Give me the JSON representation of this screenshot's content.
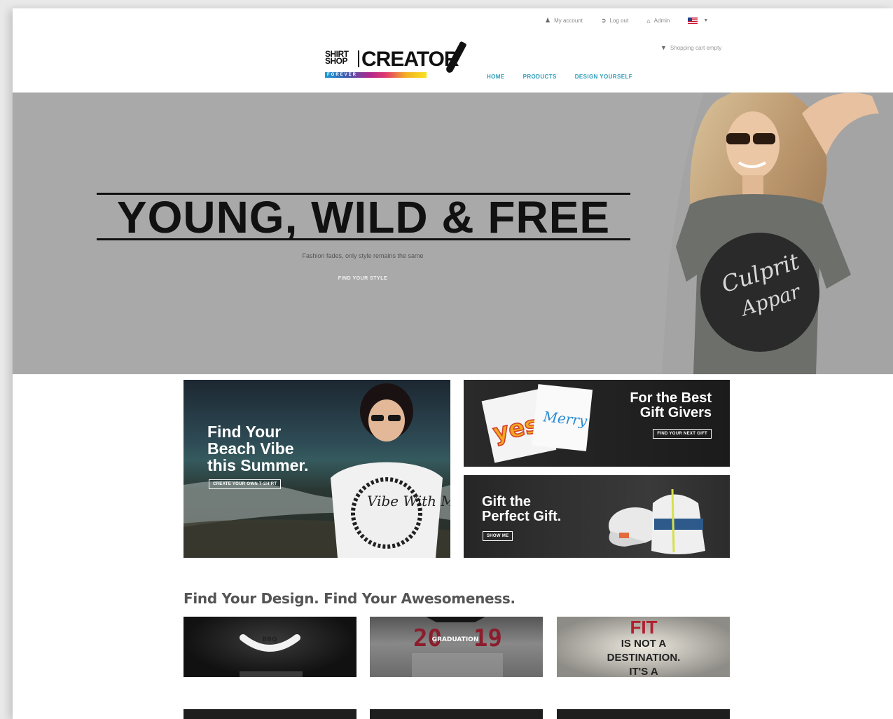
{
  "utility_bar": {
    "my_account": "My account",
    "log_out": "Log out",
    "admin": "Admin"
  },
  "cart": {
    "label": "Shopping cart empty"
  },
  "logo": {
    "shirt": "SHIRT",
    "shop": "SHOP",
    "creator": "CREATOR",
    "forever": "FOREVER"
  },
  "nav": {
    "items": [
      "HOME",
      "PRODUCTS",
      "DESIGN YOURSELF"
    ]
  },
  "hero": {
    "title": "YOUNG, WILD & FREE",
    "subtitle": "Fashion fades, only style remains the same",
    "button": "FIND YOUR STYLE",
    "shirt_text_1": "Culprit",
    "shirt_text_2": "Appar"
  },
  "promos": {
    "beach": {
      "line1": "Find Your",
      "line2": "Beach Vibe",
      "line3": "this Summer.",
      "button": "CREATE YOUR OWN T-SHIRT",
      "shirt_text": "Vibe With Me"
    },
    "gift_givers": {
      "line1": "For the Best",
      "line2": "Gift Givers",
      "button": "FIND YOUR NEXT GIFT"
    },
    "perfect_gift": {
      "line1": "Gift the",
      "line2": "Perfect Gift.",
      "button": "SHOW ME"
    }
  },
  "designs": {
    "title": "Find Your Design. Find Your Awesomeness.",
    "items": [
      {
        "text": "BBQ"
      },
      {
        "text_left": "20",
        "text_mid": "GRADUATION",
        "text_right": "19"
      },
      {
        "line1": "FIT",
        "line2": "IS NOT A",
        "line3": "DESTINATION.",
        "line4": "IT'S A"
      }
    ]
  }
}
